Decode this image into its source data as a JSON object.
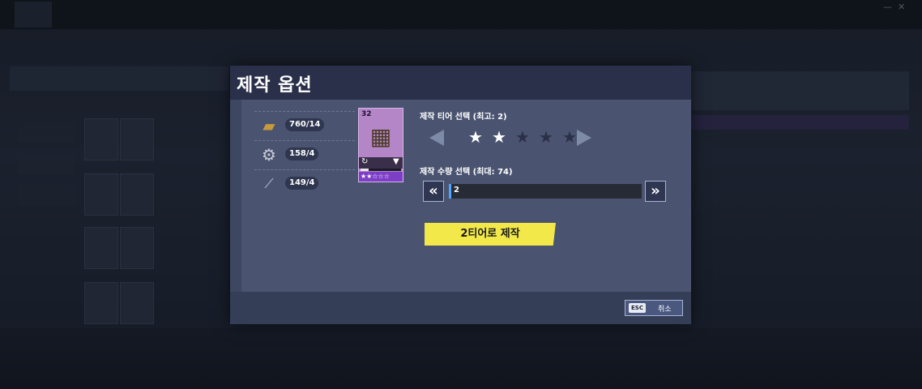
{
  "dialog": {
    "title": "제작 옵션",
    "materials": [
      {
        "icon": "wood-plank-icon",
        "count": "760/14"
      },
      {
        "icon": "mechanical-part-icon",
        "count": "158/4"
      },
      {
        "icon": "wire-icon",
        "count": "149/4"
      }
    ],
    "item": {
      "level": "32",
      "icon": "weapon-schematic-icon",
      "tier_stars": "★★☆☆☆",
      "durability": 0.2
    },
    "tier": {
      "label": "제작 티어 선택 (최고: 2)",
      "selected": 2,
      "max_stars": 5
    },
    "quantity": {
      "label": "제작 수량 선택 (최대: 74)",
      "value": "2",
      "decrement": "«",
      "increment": "»"
    },
    "craft_button": "2티어로 제작",
    "cancel": {
      "key": "ESC",
      "label": "취소"
    }
  },
  "colors": {
    "accent": "#f2e84a",
    "rarity_epic": "#b486c8",
    "slider_handle": "#4fa6ff"
  }
}
